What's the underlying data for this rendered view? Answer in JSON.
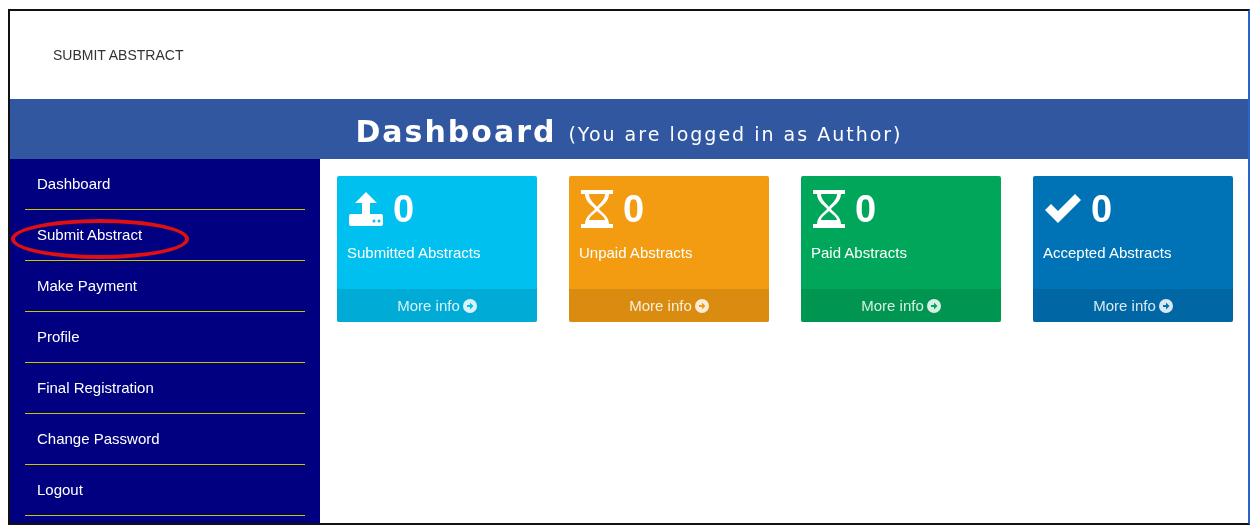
{
  "header": {
    "title": "SUBMIT ABSTRACT"
  },
  "banner": {
    "title": "Dashboard",
    "subtitle": "(You are logged in as Author)"
  },
  "sidebar": {
    "items": [
      {
        "label": "Dashboard",
        "circled": false
      },
      {
        "label": "Submit Abstract",
        "circled": true
      },
      {
        "label": "Make Payment",
        "circled": false
      },
      {
        "label": "Profile",
        "circled": false
      },
      {
        "label": "Final Registration",
        "circled": false
      },
      {
        "label": "Change Password",
        "circled": false
      },
      {
        "label": "Logout",
        "circled": false
      }
    ]
  },
  "cards": [
    {
      "kind": "upload",
      "count": "0",
      "label": "Submitted Abstracts",
      "link": "More info",
      "color": "#00c0ef"
    },
    {
      "kind": "hourglass",
      "count": "0",
      "label": "Unpaid Abstracts",
      "link": "More info",
      "color": "#f39c12"
    },
    {
      "kind": "hourglass",
      "count": "0",
      "label": "Paid Abstracts",
      "link": "More info",
      "color": "#00a65a"
    },
    {
      "kind": "check",
      "count": "0",
      "label": "Accepted Abstracts",
      "link": "More info",
      "color": "#0073b7"
    }
  ]
}
